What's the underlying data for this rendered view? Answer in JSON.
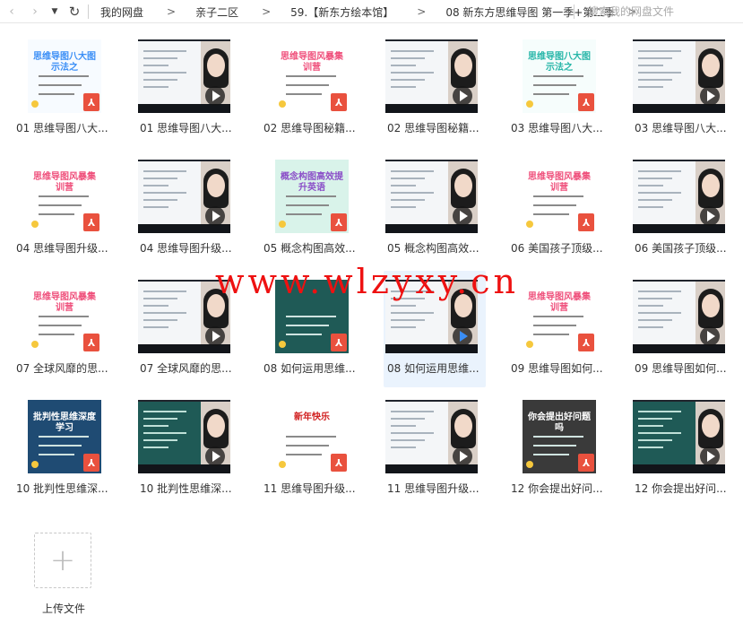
{
  "toolbar": {
    "back_icon": "‹",
    "forward_icon": "›",
    "dropdown_icon": "▼",
    "refresh_icon": "↻",
    "search_placeholder": "搜索我的网盘文件"
  },
  "breadcrumb": {
    "items": [
      "我的网盘",
      "亲子二区",
      "59.【新东方绘本馆】",
      "08 新东方思维导图 第一季+第二季"
    ],
    "arrow": ">"
  },
  "files": [
    {
      "name": "01 思维导图八大...",
      "kind": "pdf",
      "title": "思维导图八大图示法之",
      "bg": "#f7fbff",
      "accent": "#3a8ef6"
    },
    {
      "name": "01 思维导图八大...",
      "kind": "video",
      "screen": "light"
    },
    {
      "name": "02 思维导图秘籍...",
      "kind": "pdf",
      "title": "思维导图风暴集训营",
      "bg": "#ffffff",
      "accent": "#ef4f7b"
    },
    {
      "name": "02 思维导图秘籍...",
      "kind": "video",
      "screen": "light"
    },
    {
      "name": "03 思维导图八大...",
      "kind": "pdf",
      "title": "思维导图八大图示法之",
      "bg": "#f6fdfc",
      "accent": "#26b6a8"
    },
    {
      "name": "03 思维导图八大...",
      "kind": "video",
      "screen": "light"
    },
    {
      "name": "04 思维导图升级...",
      "kind": "pdf",
      "title": "思维导图风暴集训营",
      "bg": "#ffffff",
      "accent": "#ef4f7b"
    },
    {
      "name": "04 思维导图升级...",
      "kind": "video",
      "screen": "light"
    },
    {
      "name": "05 概念构图高效...",
      "kind": "pdf",
      "title": "概念构图高效提升英语",
      "bg": "#d9f3ea",
      "accent": "#8b4fc8"
    },
    {
      "name": "05 概念构图高效...",
      "kind": "video",
      "screen": "light"
    },
    {
      "name": "06 美国孩子顶级...",
      "kind": "pdf",
      "title": "思维导图风暴集训营",
      "bg": "#ffffff",
      "accent": "#ef4f7b"
    },
    {
      "name": "06 美国孩子顶级...",
      "kind": "video",
      "screen": "light"
    },
    {
      "name": "07 全球风靡的思...",
      "kind": "pdf",
      "title": "思维导图风暴集训营",
      "bg": "#ffffff",
      "accent": "#ef4f7b"
    },
    {
      "name": "07 全球风靡的思...",
      "kind": "video",
      "screen": "light"
    },
    {
      "name": "08 如何运用思维...",
      "kind": "pdf",
      "title": "",
      "bg": "#1f5a56",
      "accent": "#bfe0d8"
    },
    {
      "name": "08 如何运用思维...",
      "kind": "video",
      "screen": "light",
      "selected": true
    },
    {
      "name": "09 思维导图如何...",
      "kind": "pdf",
      "title": "思维导图风暴集训营",
      "bg": "#ffffff",
      "accent": "#ef4f7b"
    },
    {
      "name": "09 思维导图如何...",
      "kind": "video",
      "screen": "light"
    },
    {
      "name": "10 批判性思维深...",
      "kind": "pdf",
      "title": "批判性思维深度学习",
      "bg": "#1f4b73",
      "accent": "#ffffff"
    },
    {
      "name": "10 批判性思维深...",
      "kind": "video",
      "screen": "dark"
    },
    {
      "name": "11 思维导图升级...",
      "kind": "pdf",
      "title": "新年快乐",
      "bg": "#ffffff",
      "accent": "#d11f1f"
    },
    {
      "name": "11 思维导图升级...",
      "kind": "video",
      "screen": "light"
    },
    {
      "name": "12 你会提出好问...",
      "kind": "pdf",
      "title": "你会提出好问题吗",
      "bg": "#3a3a3a",
      "accent": "#ffffff"
    },
    {
      "name": "12 你会提出好问...",
      "kind": "video",
      "screen": "dark"
    }
  ],
  "watermark": "www.wlzyxy.cn",
  "upload": {
    "label": "上传文件",
    "icon": "+"
  },
  "colors": {
    "selected_bg": "#eaf3fd",
    "pdf_badge": "#e9513e",
    "watermark": "#ee1111"
  }
}
